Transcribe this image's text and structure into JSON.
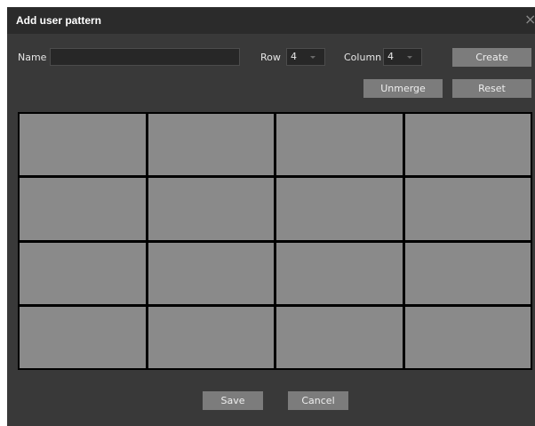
{
  "dialog": {
    "title": "Add user pattern",
    "close_glyph": "×"
  },
  "form": {
    "name_label": "Name",
    "name_value": "",
    "row_label": "Row",
    "row_value": "4",
    "column_label": "Column",
    "column_value": "4"
  },
  "buttons": {
    "create": "Create",
    "unmerge": "Unmerge",
    "reset": "Reset",
    "save": "Save",
    "cancel": "Cancel"
  },
  "pattern_grid": {
    "rows": 4,
    "columns": 4
  },
  "colors": {
    "dialog_bg": "#393939",
    "titlebar_bg": "#2b2b2b",
    "cell_fill": "#8a8a8a",
    "button_bg": "#7c7c7c"
  }
}
